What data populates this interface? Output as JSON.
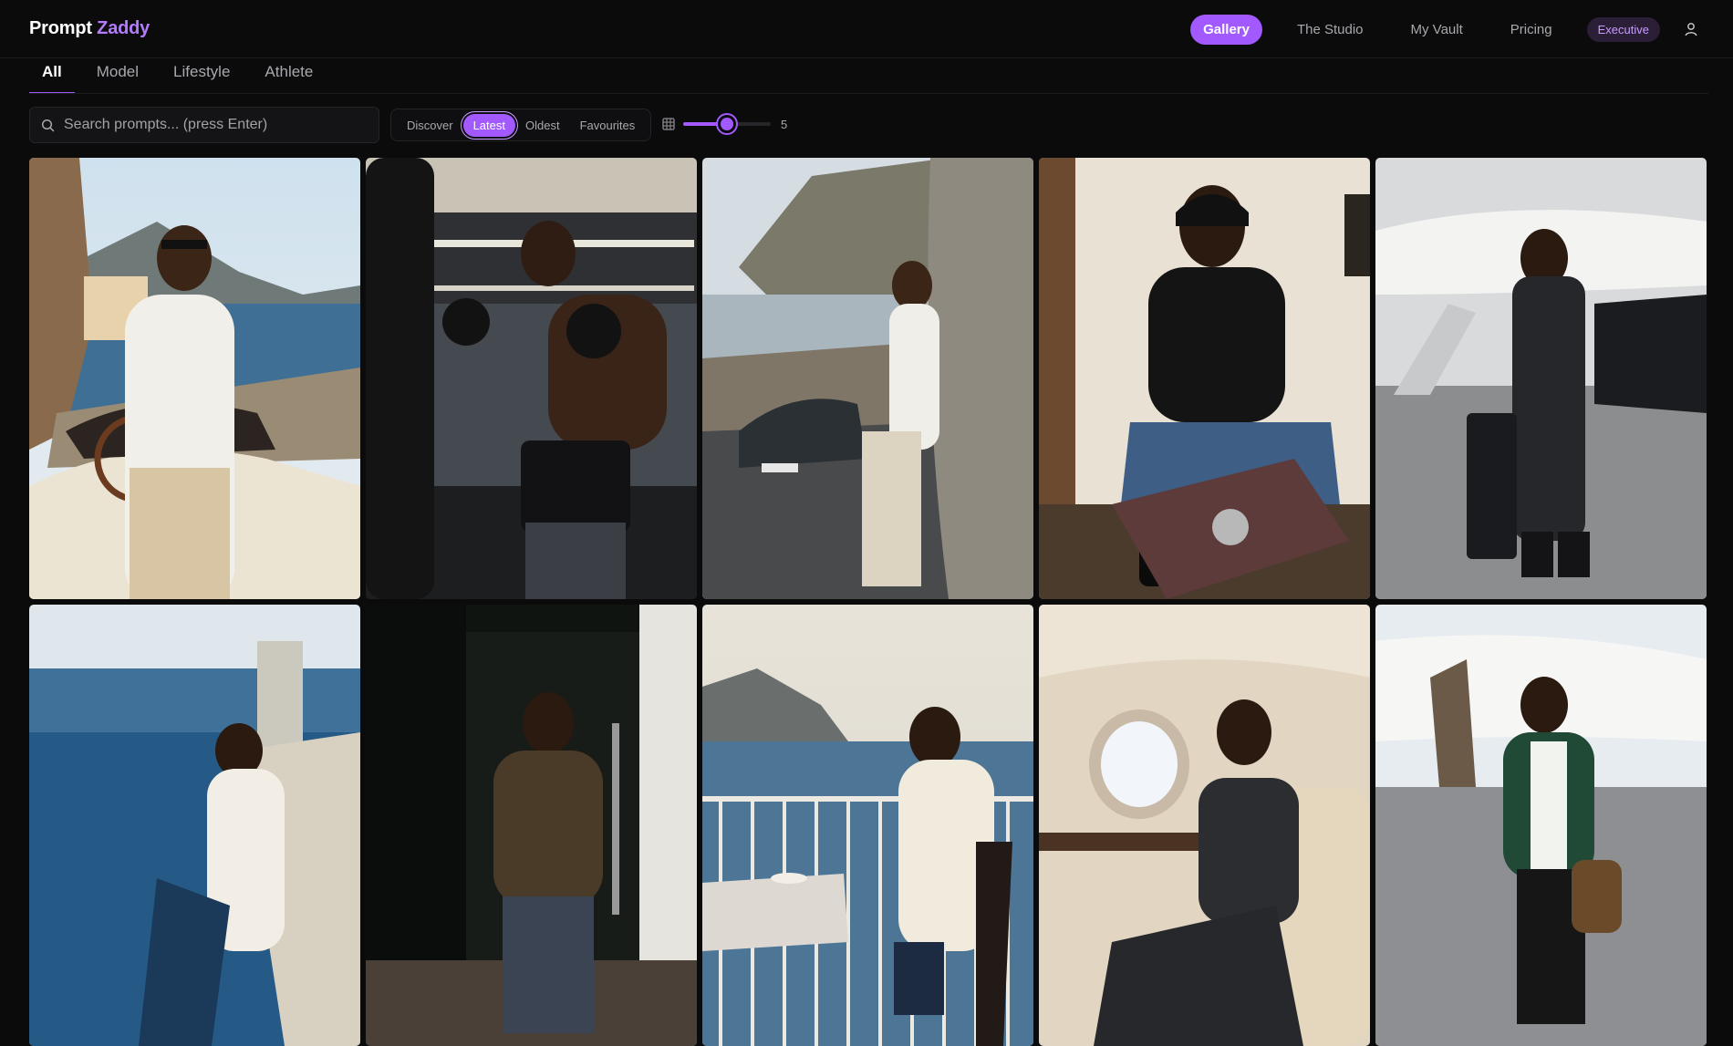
{
  "brand": {
    "part1": "Prompt",
    "part2": "Zaddy"
  },
  "nav": {
    "items": [
      {
        "label": "Gallery",
        "active": true
      },
      {
        "label": "The Studio",
        "active": false
      },
      {
        "label": "My Vault",
        "active": false
      },
      {
        "label": "Pricing",
        "active": false
      }
    ],
    "badge": "Executive",
    "user_icon": "user-icon"
  },
  "tabs": [
    {
      "label": "All",
      "active": true
    },
    {
      "label": "Model",
      "active": false
    },
    {
      "label": "Lifestyle",
      "active": false
    },
    {
      "label": "Athlete",
      "active": false
    }
  ],
  "search": {
    "placeholder": "Search prompts... (press Enter)",
    "value": "",
    "icon": "search-icon"
  },
  "sort": {
    "options": [
      {
        "label": "Discover",
        "active": false
      },
      {
        "label": "Latest",
        "active": true
      },
      {
        "label": "Oldest",
        "active": false
      },
      {
        "label": "Favourites",
        "active": false
      }
    ]
  },
  "columns": {
    "icon": "grid-icon",
    "value": "5",
    "fraction": 0.5,
    "accent": "#a259ff"
  },
  "gallery": [
    {
      "icon": "coastal-convertible-photo"
    },
    {
      "icon": "boxing-gym-photo"
    },
    {
      "icon": "cliffside-porsche-photo"
    },
    {
      "icon": "hotel-watch-tray-photo"
    },
    {
      "icon": "jet-tarmac-luggage-photo"
    },
    {
      "icon": "infinity-pool-photo"
    },
    {
      "icon": "doorway-overcoat-photo"
    },
    {
      "icon": "balcony-breakfast-photo"
    },
    {
      "icon": "jet-cabin-photo"
    },
    {
      "icon": "jet-runway-walk-photo"
    }
  ]
}
